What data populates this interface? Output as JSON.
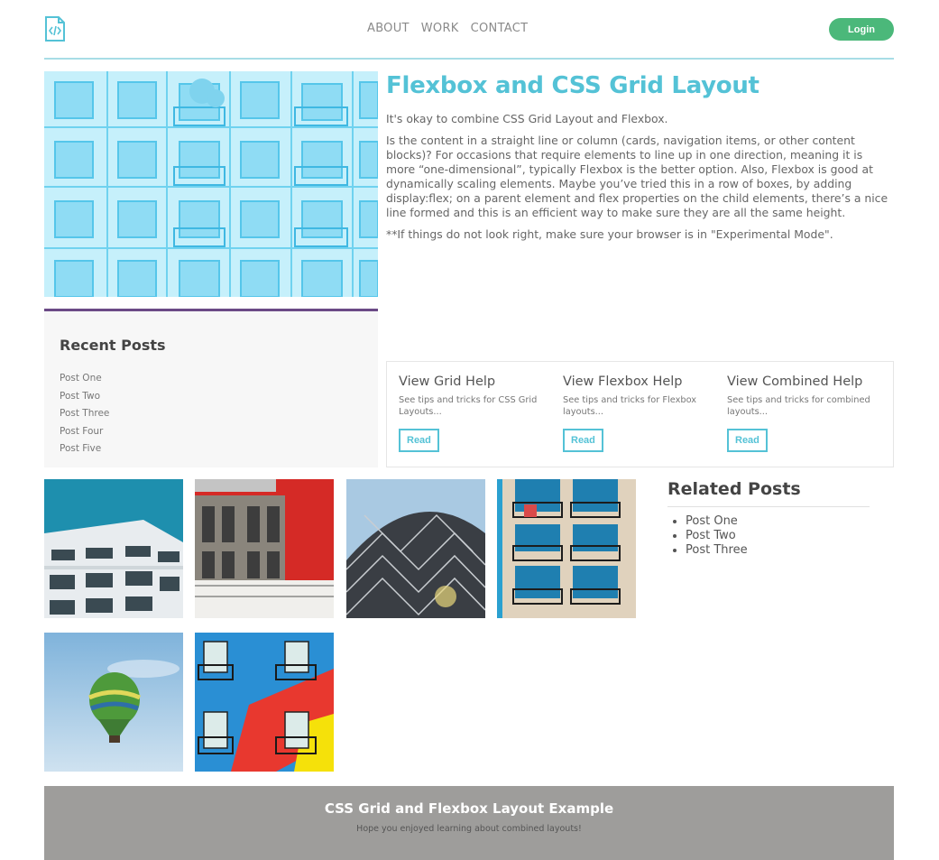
{
  "header": {
    "logo_icon": "code-file-icon",
    "nav": [
      "ABOUT",
      "WORK",
      "CONTACT"
    ],
    "login_label": "Login",
    "accent": "#54c2d6",
    "login_color": "#4bb87a"
  },
  "article": {
    "title": "Flexbox and CSS Grid Layout",
    "paragraphs": [
      "It's okay to combine CSS Grid Layout and Flexbox.",
      "Is the content in a straight line or column (cards, navigation items, or other content blocks)? For occasions that require elements to line up in one direction, meaning it is more “one-dimensional”, typically Flexbox is the better option. Also, Flexbox is good at dynamically scaling elements. Maybe you’ve tried this in a row of boxes, by adding display:flex; on a parent element and flex properties on the child elements, there’s a nice line formed and this is an efficient way to make sure they are all the same height.",
      "**If things do not look right, make sure your browser is in \"Experimental Mode\"."
    ]
  },
  "recent": {
    "title": "Recent Posts",
    "items": [
      "Post One",
      "Post Two",
      "Post Three",
      "Post Four",
      "Post Five"
    ]
  },
  "help": {
    "cards": [
      {
        "title": "View Grid Help",
        "text": "See tips and tricks for CSS Grid Layouts...",
        "button": "Read"
      },
      {
        "title": "View Flexbox Help",
        "text": "See tips and tricks for Flexbox layouts...",
        "button": "Read"
      },
      {
        "title": "View Combined Help",
        "text": "See tips and tricks for combined layouts...",
        "button": "Read"
      }
    ]
  },
  "related": {
    "title": "Related Posts",
    "items": [
      "Post One",
      "Post Two",
      "Post Three"
    ]
  },
  "footer": {
    "title": "CSS Grid and Flexbox Layout Example",
    "subtitle": "Hope you enjoyed learning about combined layouts!",
    "background": "#9e9d9b"
  }
}
